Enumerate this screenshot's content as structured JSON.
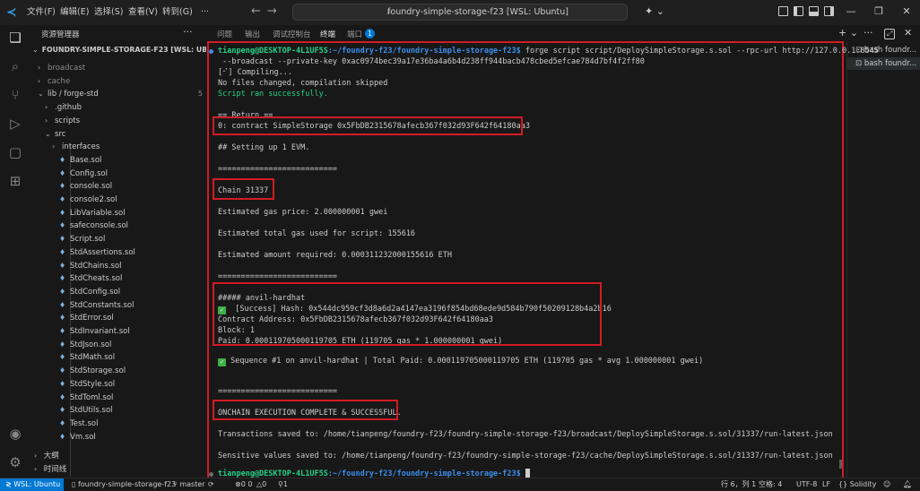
{
  "menu": [
    "文件(F)",
    "编辑(E)",
    "选择(S)",
    "查看(V)",
    "转到(G)"
  ],
  "menu_more": "···",
  "search_text": "foundry-simple-storage-f23 [WSL: Ubuntu]",
  "sidebar": {
    "title": "资源管理器",
    "root": "FOUNDRY-SIMPLE-STORAGE-F23 [WSL: UBUNTU]",
    "lib_badge": "5",
    "items": [
      {
        "label": "broadcast",
        "kind": "folder"
      },
      {
        "label": "cache",
        "kind": "folder"
      },
      {
        "label": "lib / forge-std",
        "kind": "folder-open"
      },
      {
        "label": ".github",
        "kind": "folder"
      },
      {
        "label": "scripts",
        "kind": "folder"
      },
      {
        "label": "src",
        "kind": "folder-open"
      },
      {
        "label": "interfaces",
        "kind": "folder"
      },
      {
        "label": "Base.sol",
        "kind": "file"
      },
      {
        "label": "Config.sol",
        "kind": "file"
      },
      {
        "label": "console.sol",
        "kind": "file"
      },
      {
        "label": "console2.sol",
        "kind": "file"
      },
      {
        "label": "LibVariable.sol",
        "kind": "file"
      },
      {
        "label": "safeconsole.sol",
        "kind": "file"
      },
      {
        "label": "Script.sol",
        "kind": "file"
      },
      {
        "label": "StdAssertions.sol",
        "kind": "file"
      },
      {
        "label": "StdChains.sol",
        "kind": "file"
      },
      {
        "label": "StdCheats.sol",
        "kind": "file"
      },
      {
        "label": "StdConfig.sol",
        "kind": "file"
      },
      {
        "label": "StdConstants.sol",
        "kind": "file"
      },
      {
        "label": "StdError.sol",
        "kind": "file"
      },
      {
        "label": "StdInvariant.sol",
        "kind": "file"
      },
      {
        "label": "StdJson.sol",
        "kind": "file"
      },
      {
        "label": "StdMath.sol",
        "kind": "file"
      },
      {
        "label": "StdStorage.sol",
        "kind": "file"
      },
      {
        "label": "StdStyle.sol",
        "kind": "file"
      },
      {
        "label": "StdToml.sol",
        "kind": "file"
      },
      {
        "label": "StdUtils.sol",
        "kind": "file"
      },
      {
        "label": "Test.sol",
        "kind": "file"
      },
      {
        "label": "Vm.sol",
        "kind": "file"
      }
    ],
    "outline": "大纲",
    "timeline": "时间线"
  },
  "panel_tabs": [
    "问题",
    "输出",
    "调试控制台",
    "终端",
    "端口"
  ],
  "port_count": "1",
  "terminal": {
    "prompt_user": "tianpeng@DESKTOP-4L1UF5S",
    "prompt_path": ":~/foundry-f23/foundry-simple-storage-f23$",
    "command": " forge script script/DeploySimpleStorage.s.sol --rpc-url http://127.0.0.1:8545",
    "command2": " --broadcast --private-key 0xac0974bec39a17e36ba4a6b4d238ff944bacb478cbed5efcae784d7bf4f2ff80",
    "compiling": "[⠊] Compiling...",
    "no_changes": "No files changed, compilation skipped",
    "script_ok": "Script ran successfully.",
    "return_hdr": "== Return ==",
    "return_val": "0: contract SimpleStorage 0x5FbDB2315678afecb367f032d93F642f64180aa3",
    "setting_up": "## Setting up 1 EVM.",
    "rule": "==========================",
    "chain": "Chain 31337",
    "gas_price": "Estimated gas price: 2.000000001 gwei",
    "gas_used": "Estimated total gas used for script: 155616",
    "amount": "Estimated amount required: 0.000311232000155616 ETH",
    "anvil_hdr": "##### anvil-hardhat",
    "success": "[Success] Hash: 0x544dc959cf3d8a6d2a4147ea3196f854bd68ede9d584b790f50209128b4a2b16",
    "contract_addr": "Contract Address: 0x5FbDB2315678afecb367f032d93F642f64180aa3",
    "block": "Block: 1",
    "paid": "Paid: 0.000119705000119705 ETH (119705 gas * 1.000000001 gwei)",
    "sequence": "Sequence #1 on anvil-hardhat | Total Paid: 0.000119705000119705 ETH (119705 gas * avg 1.000000001 gwei)",
    "complete": "ONCHAIN EXECUTION COMPLETE & SUCCESSFUL.",
    "tx_saved": "Transactions saved to: /home/tianpeng/foundry-f23/foundry-simple-storage-f23/broadcast/DeploySimpleStorage.s.sol/31337/run-latest.json",
    "sens_saved": "Sensitive values saved to: /home/tianpeng/foundry-f23/foundry-simple-storage-f23/cache/DeploySimpleStorage.s.sol/31337/run-latest.json"
  },
  "terminal_list": [
    "bash foundr...",
    "bash foundr..."
  ],
  "status": {
    "remote": "WSL: Ubuntu",
    "folder": "foundry-simple-storage-f23",
    "branch": "master",
    "problems": "0 0",
    "warnings": "0",
    "ports": "1",
    "position": "行 6，列 1",
    "spaces": "空格: 4",
    "encoding": "UTF-8",
    "eol": "LF",
    "language": "Solidity"
  },
  "colors": {
    "accent": "#0078d4",
    "highlight_box": "#d11c24",
    "prompt_green": "#23d18b",
    "path_blue": "#3b8eea"
  }
}
